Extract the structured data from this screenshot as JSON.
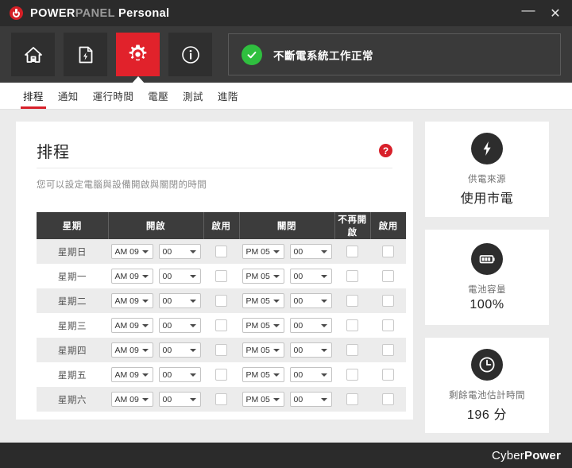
{
  "window": {
    "brand_part1": "POWER",
    "brand_part2": "PANEL",
    "brand_part3": "Personal",
    "minimize_label": "—",
    "close_label": "✕"
  },
  "toolbar": {
    "buttons": [
      {
        "name": "home",
        "label": "home-icon"
      },
      {
        "name": "report",
        "label": "report-icon"
      },
      {
        "name": "settings",
        "label": "gear-icon"
      },
      {
        "name": "info",
        "label": "info-icon"
      }
    ],
    "status_text": "不斷電系統工作正常",
    "status_color": "#2fbf3f"
  },
  "tabs": [
    {
      "label": "排程",
      "active": true
    },
    {
      "label": "通知",
      "active": false
    },
    {
      "label": "運行時間",
      "active": false
    },
    {
      "label": "電壓",
      "active": false
    },
    {
      "label": "測試",
      "active": false
    },
    {
      "label": "進階",
      "active": false
    }
  ],
  "panel": {
    "title": "排程",
    "help_label": "?",
    "subtitle": "您可以設定電腦與設備開啟與關閉的時間",
    "headers": {
      "day": "星期",
      "on": "開啟",
      "on_enable": "啟用",
      "off": "關閉",
      "no_restart": "不再開啟",
      "off_enable": "啟用"
    },
    "rows": [
      {
        "day": "星期日",
        "on_hour": "AM 09",
        "on_min": "00",
        "on_enabled": false,
        "off_hour": "PM 05",
        "off_min": "00",
        "no_restart": false,
        "off_enabled": false
      },
      {
        "day": "星期一",
        "on_hour": "AM 09",
        "on_min": "00",
        "on_enabled": false,
        "off_hour": "PM 05",
        "off_min": "00",
        "no_restart": false,
        "off_enabled": false
      },
      {
        "day": "星期二",
        "on_hour": "AM 09",
        "on_min": "00",
        "on_enabled": false,
        "off_hour": "PM 05",
        "off_min": "00",
        "no_restart": false,
        "off_enabled": false
      },
      {
        "day": "星期三",
        "on_hour": "AM 09",
        "on_min": "00",
        "on_enabled": false,
        "off_hour": "PM 05",
        "off_min": "00",
        "no_restart": false,
        "off_enabled": false
      },
      {
        "day": "星期四",
        "on_hour": "AM 09",
        "on_min": "00",
        "on_enabled": false,
        "off_hour": "PM 05",
        "off_min": "00",
        "no_restart": false,
        "off_enabled": false
      },
      {
        "day": "星期五",
        "on_hour": "AM 09",
        "on_min": "00",
        "on_enabled": false,
        "off_hour": "PM 05",
        "off_min": "00",
        "no_restart": false,
        "off_enabled": false
      },
      {
        "day": "星期六",
        "on_hour": "AM 09",
        "on_min": "00",
        "on_enabled": false,
        "off_hour": "PM 05",
        "off_min": "00",
        "no_restart": false,
        "off_enabled": false
      }
    ]
  },
  "sidebar": {
    "cards": [
      {
        "icon": "bolt-icon",
        "label": "供電來源",
        "value": "使用市電"
      },
      {
        "icon": "battery-icon",
        "label": "電池容量",
        "value": "100%"
      },
      {
        "icon": "clock-icon",
        "label": "剩餘電池估計時間",
        "value": "196 分"
      }
    ]
  },
  "footer": {
    "logo_part1": "Cyber",
    "logo_part2": "Power"
  }
}
